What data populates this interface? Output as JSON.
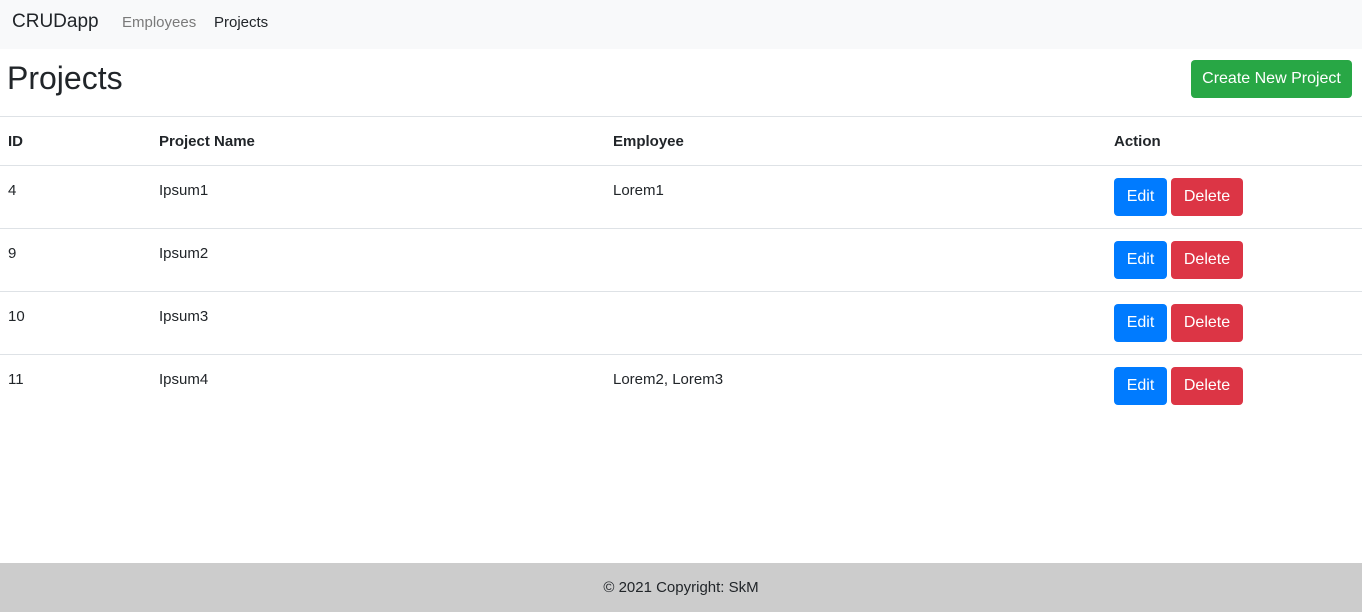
{
  "navbar": {
    "brand": "CRUDapp",
    "links": [
      {
        "label": "Employees"
      },
      {
        "label": "Projects"
      }
    ]
  },
  "page": {
    "title": "Projects",
    "create_button": "Create New Project"
  },
  "table": {
    "headers": [
      "ID",
      "Project Name",
      "Employee",
      "Action"
    ],
    "rows": [
      {
        "id": "4",
        "name": "Ipsum1",
        "employee": "Lorem1",
        "edit": "Edit",
        "delete": "Delete"
      },
      {
        "id": "9",
        "name": "Ipsum2",
        "employee": "",
        "edit": "Edit",
        "delete": "Delete"
      },
      {
        "id": "10",
        "name": "Ipsum3",
        "employee": "",
        "edit": "Edit",
        "delete": "Delete"
      },
      {
        "id": "11",
        "name": "Ipsum4",
        "employee": "Lorem2, Lorem3",
        "edit": "Edit",
        "delete": "Delete"
      }
    ]
  },
  "footer": {
    "text": "© 2021 Copyright: SkM"
  },
  "colors": {
    "primary": "#007bff",
    "success": "#28a745",
    "danger": "#dc3545",
    "navbar_bg": "#f8f9fa",
    "footer_bg": "#cccccc"
  }
}
